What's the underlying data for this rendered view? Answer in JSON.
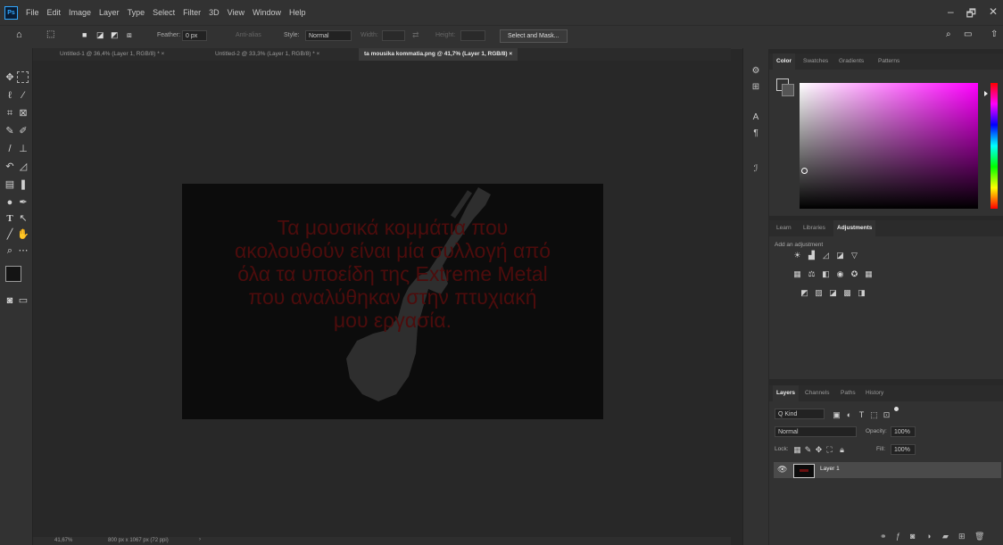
{
  "menubar": {
    "app_icon": "Ps",
    "items": [
      "File",
      "Edit",
      "Image",
      "Layer",
      "Type",
      "Select",
      "Filter",
      "3D",
      "View",
      "Window",
      "Help"
    ],
    "window_controls": [
      "–",
      "🗗",
      "✕"
    ]
  },
  "options": {
    "feather_label": "Feather:",
    "feather_value": "0 px",
    "antialias_label": "Anti-alias",
    "style_label": "Style:",
    "style_value": "Normal",
    "width_label": "Width:",
    "height_label": "Height:",
    "select_mask_button": "Select and Mask..."
  },
  "tabs": [
    {
      "label": "Untitled-1 @ 36,4% (Layer 1, RGB/8) *",
      "close": "×"
    },
    {
      "label": "Untitled-2 @ 33,3% (Layer 1, RGB/8) *",
      "close": "×"
    },
    {
      "label": "ta mousika kommatia.png @ 41,7% (Layer 1, RGB/8)",
      "close": "×"
    }
  ],
  "document": {
    "text_lines": [
      "Τα μουσικά κομμάτια που",
      "ακολουθούν είναι μία συλλογή από",
      "όλα τα υποείδη της Extreme Metal",
      "που αναλύθηκαν στην πτυχιακή",
      "μου εργασία."
    ],
    "text_color": "#4d0c0c",
    "background_color": "#0c0c0c"
  },
  "status": {
    "zoom": "41,67%",
    "doc_size": "800 px x 1067 px (72 ppi)"
  },
  "color_panel": {
    "tabs": [
      "Color",
      "Swatches",
      "Gradients",
      "Patterns"
    ],
    "active_tab": "Color",
    "hue_color": "#ff00ff"
  },
  "adjust_panel": {
    "tabs": [
      "Learn",
      "Libraries",
      "Adjustments"
    ],
    "active_tab": "Adjustments",
    "add_label": "Add an adjustment"
  },
  "layers_panel": {
    "tabs": [
      "Layers",
      "Channels",
      "Paths",
      "History"
    ],
    "active_tab": "Layers",
    "kind_label": "Q Kind",
    "blend_mode": "Normal",
    "opacity_label": "Opacity:",
    "opacity_value": "100%",
    "lock_label": "Lock:",
    "fill_label": "Fill:",
    "fill_value": "100%",
    "layers": [
      {
        "name": "Layer 1"
      }
    ]
  }
}
